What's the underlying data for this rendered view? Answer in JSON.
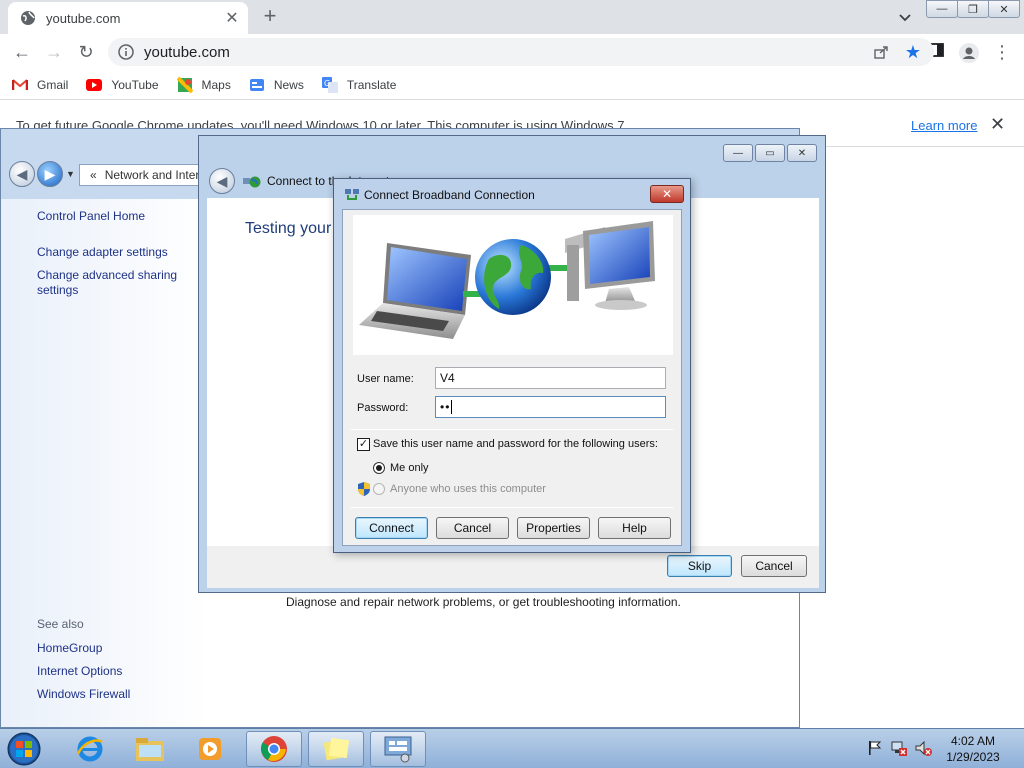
{
  "browser": {
    "tab": {
      "title": "youtube.com",
      "close_glyph": "✕"
    },
    "new_tab_glyph": "+",
    "window_buttons": {
      "minimize": "—",
      "restore": "❐",
      "close": "✕"
    },
    "address": "youtube.com",
    "bookmarks": [
      {
        "label": "Gmail",
        "icon": "gmail-icon"
      },
      {
        "label": "YouTube",
        "icon": "youtube-icon"
      },
      {
        "label": "Maps",
        "icon": "maps-icon"
      },
      {
        "label": "News",
        "icon": "news-icon"
      },
      {
        "label": "Translate",
        "icon": "translate-icon"
      }
    ],
    "infobar": {
      "message": "To get future Google Chrome updates, you'll need Windows 10 or later. This computer is using Windows 7.",
      "link": "Learn more",
      "close_glyph": "✕"
    }
  },
  "network_center": {
    "address_prefix": "«",
    "address": "Network and Internet",
    "sidebar": {
      "home": "Control Panel Home",
      "adapter": "Change adapter settings",
      "sharing": "Change advanced sharing settings",
      "see_also": "See also",
      "homegroup": "HomeGroup",
      "internet_options": "Internet Options",
      "firewall": "Windows Firewall"
    },
    "diagnose_text": "Diagnose and repair network problems, or get troubleshooting information."
  },
  "wizard": {
    "title": "Connect to the Internet",
    "heading": "Testing your Internet connection",
    "skip_label": "Skip",
    "cancel_label": "Cancel",
    "buttons": {
      "minimize": "—",
      "restore": "▭",
      "close": "✕"
    }
  },
  "dialog": {
    "title": "Connect Broadband Connection",
    "close_glyph": "✕",
    "username_label": "User name:",
    "username_value": "V4",
    "password_label": "Password:",
    "password_value": "••",
    "save_label": "Save this user name and password for the following users:",
    "save_checked": true,
    "me_only_label": "Me only",
    "anyone_label": "Anyone who uses this computer",
    "connect_label": "Connect",
    "cancel_label": "Cancel",
    "properties_label": "Properties",
    "help_label": "Help"
  },
  "taskbar": {
    "time": "4:02 AM",
    "date": "1/29/2023"
  },
  "colors": {
    "chrome_tabstrip": "#dee1e6",
    "link_blue": "#1a73e8",
    "win7_frame": "#bcd1ea",
    "taskbar": "#8fb0d8"
  }
}
